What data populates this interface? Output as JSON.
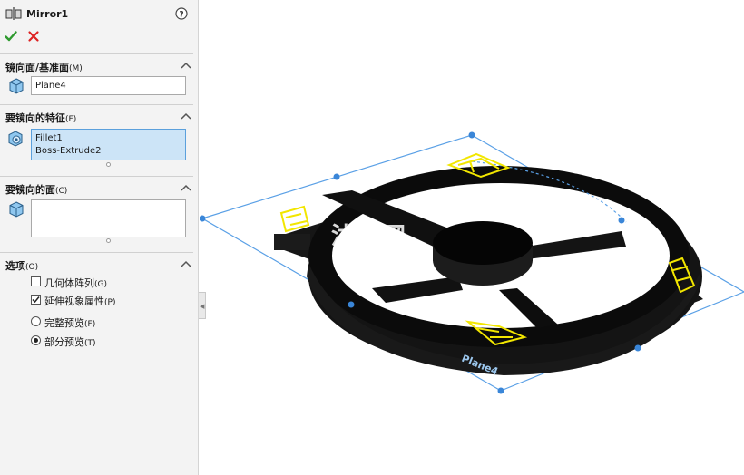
{
  "panel": {
    "title": "Mirror1",
    "ok_label": "✔",
    "cancel_label": "✕",
    "sections": {
      "mirror_plane": {
        "title": "镜向面/基准面",
        "hotkey": "(M)",
        "value": "Plane4"
      },
      "features": {
        "title": "要镜向的特征",
        "hotkey": "(F)",
        "items": [
          "Fillet1",
          "Boss-Extrude2"
        ]
      },
      "faces": {
        "title": "要镜向的面",
        "hotkey": "(C)",
        "items": []
      },
      "options": {
        "title": "选项",
        "hotkey": "(O)",
        "geometry_pattern": {
          "label": "几何体阵列",
          "hotkey": "(G)",
          "checked": false
        },
        "propagate_visual": {
          "label": "延伸视象属性",
          "hotkey": "(P)",
          "checked": true
        },
        "full_preview": {
          "label": "完整预览",
          "hotkey": "(F)",
          "selected": false
        },
        "partial_preview": {
          "label": "部分预览",
          "hotkey": "(T)",
          "selected": true
        }
      }
    }
  },
  "viewport": {
    "plane_label": "Plane4",
    "watermark": "沐风网",
    "watermark_url": "www.mfcad.com",
    "colors": {
      "plane_edge": "#5aa0e6",
      "handle": "#3a86d8",
      "model": "#111111",
      "selection": "#f2e600"
    }
  }
}
